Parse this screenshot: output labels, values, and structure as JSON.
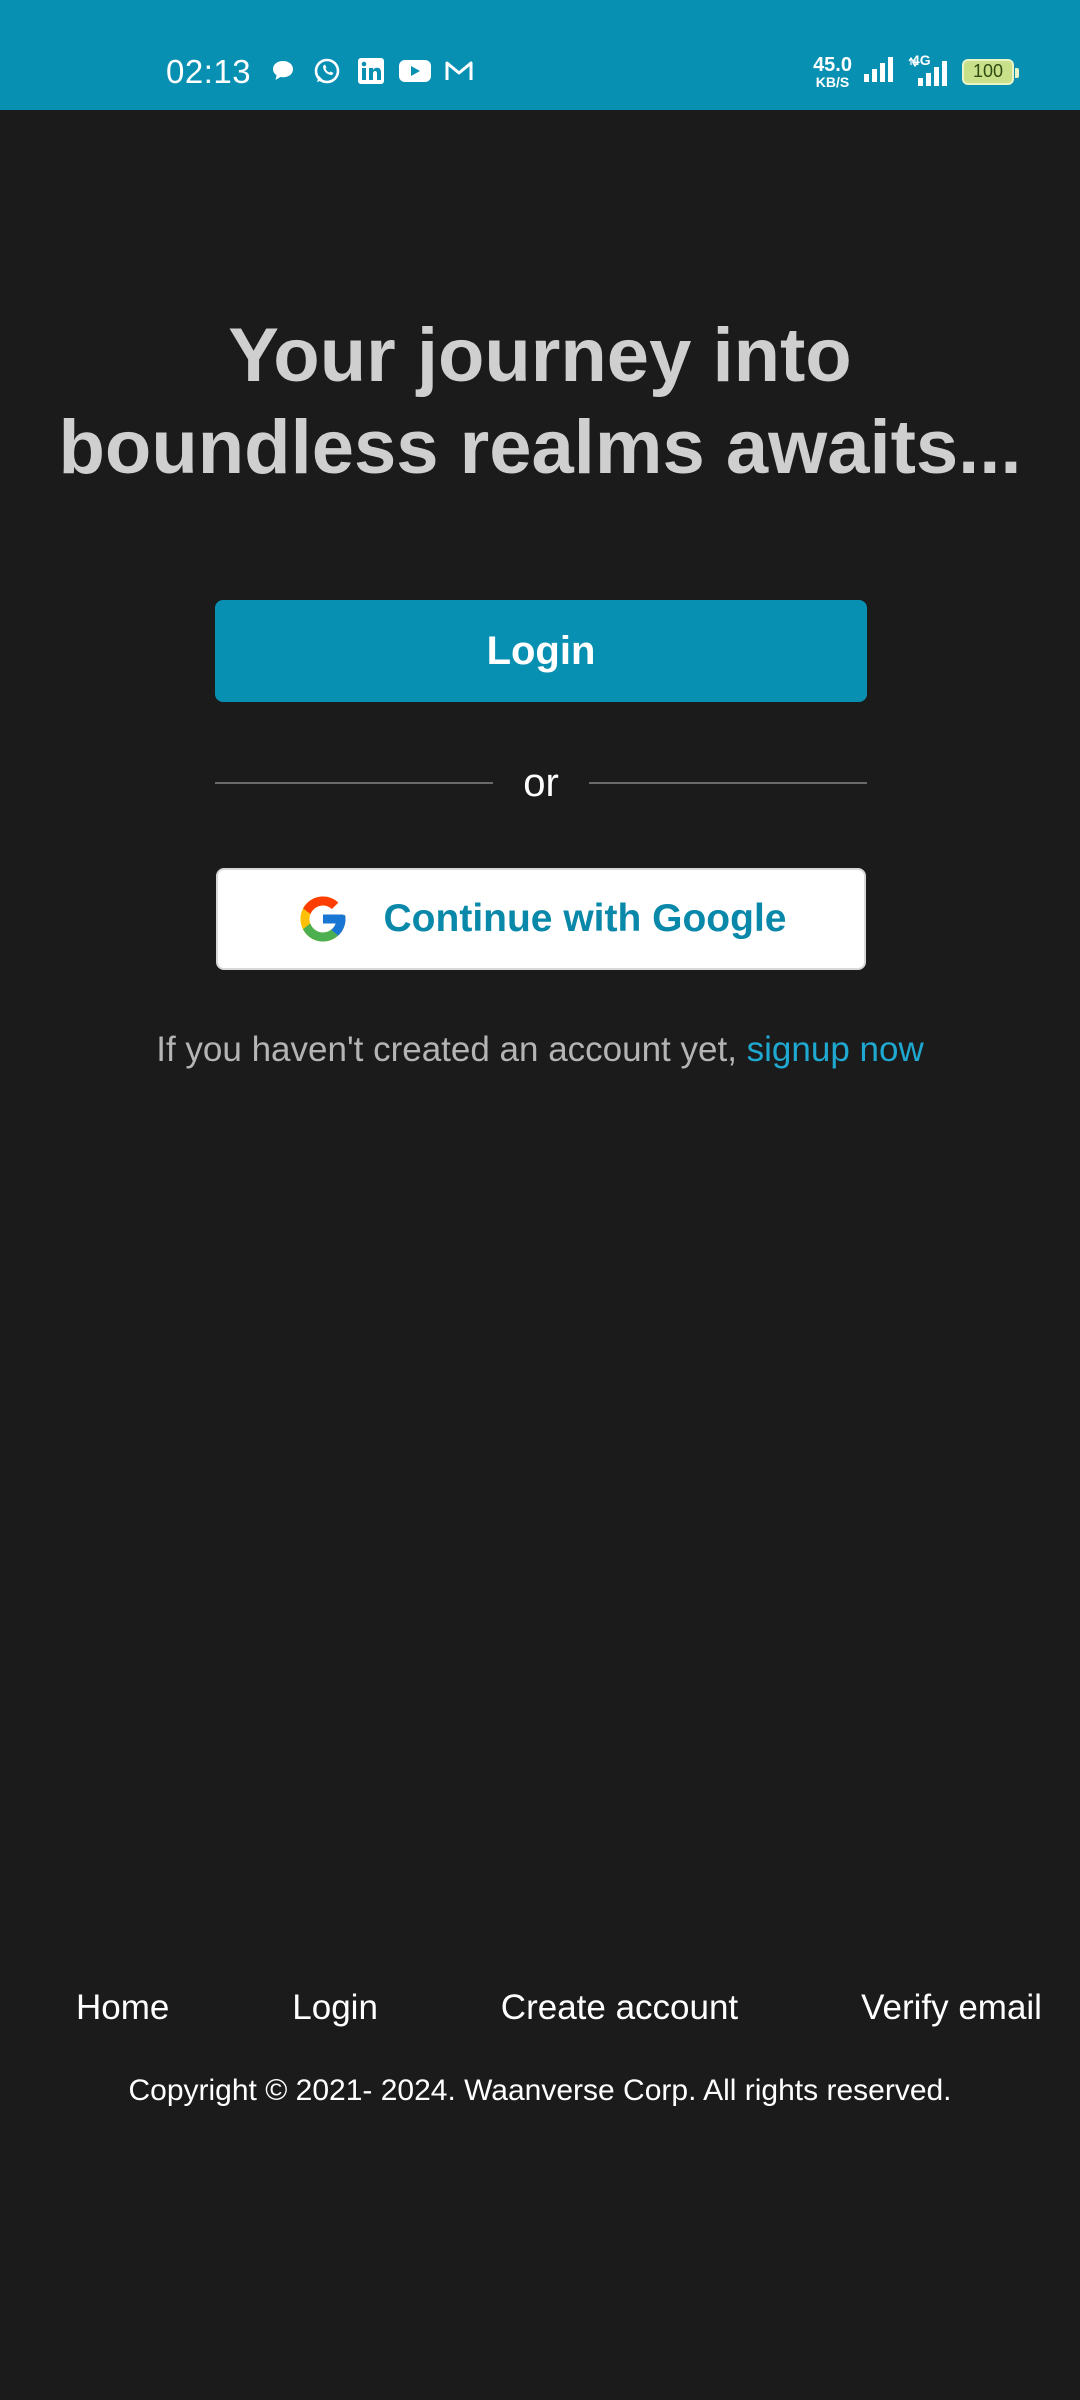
{
  "status_bar": {
    "time": "02:13",
    "net_speed_value": "45.0",
    "net_speed_unit": "KB/S",
    "network_type": "4G",
    "battery": "100",
    "notification_icons": [
      "chat-bubble-icon",
      "whatsapp-icon",
      "linkedin-icon",
      "youtube-icon",
      "gmail-icon"
    ],
    "color": "#0890b3"
  },
  "main": {
    "headline": "Your journey into boundless realms awaits...",
    "login_label": "Login",
    "or_label": "or",
    "google_label": "Continue with Google",
    "signup_prefix": "If you haven't created an account yet,",
    "signup_link": "signup now"
  },
  "footer": {
    "nav": [
      "Home",
      "Login",
      "Create account",
      "Verify email"
    ],
    "copyright": "Copyright © 2021- 2024. Waanverse Corp. All rights reserved."
  },
  "colors": {
    "background": "#1b1b1b",
    "accent": "#0890b3",
    "link": "#1fa8d0"
  }
}
